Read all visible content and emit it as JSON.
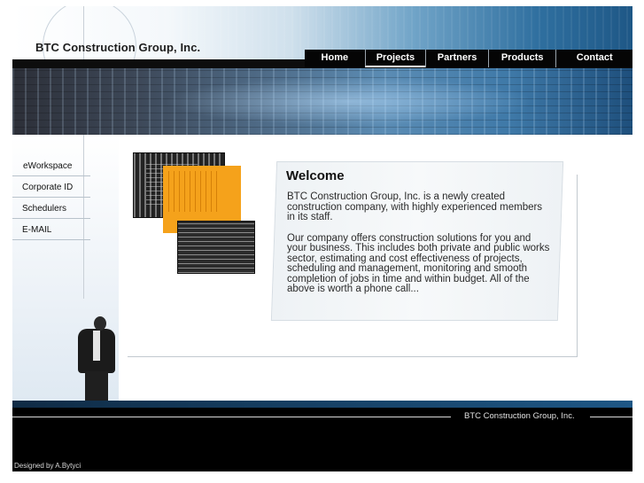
{
  "header": {
    "company_title": "BTC Construction Group, Inc."
  },
  "nav": {
    "tabs": [
      {
        "label": "Home"
      },
      {
        "label": "Projects"
      },
      {
        "label": "Partners"
      },
      {
        "label": "Products"
      },
      {
        "label": "Contact"
      }
    ],
    "active": "Projects"
  },
  "side_menu": {
    "items": [
      {
        "label": "eWorkspace"
      },
      {
        "label": "Corporate ID"
      },
      {
        "label": "Schedulers"
      },
      {
        "label": "E-MAIL"
      }
    ]
  },
  "welcome": {
    "heading": "Welcome",
    "paragraph_1": "BTC Construction Group, Inc. is a newly created construction company, with highly experienced members in its staff.",
    "paragraph_2": "Our company offers construction solutions for you and your business. This includes both private and public works sector, estimating and cost effectiveness of projects, scheduling and management, monitoring and smooth completion of jobs in time and within budget. All of the above is worth a phone call..."
  },
  "footer": {
    "company": "BTC Construction Group, Inc.",
    "credit": "Designed by A.Bytyci"
  },
  "colors": {
    "accent_orange": "#f5a21b",
    "header_blue": "#1e5786",
    "nav_black": "#050505"
  }
}
